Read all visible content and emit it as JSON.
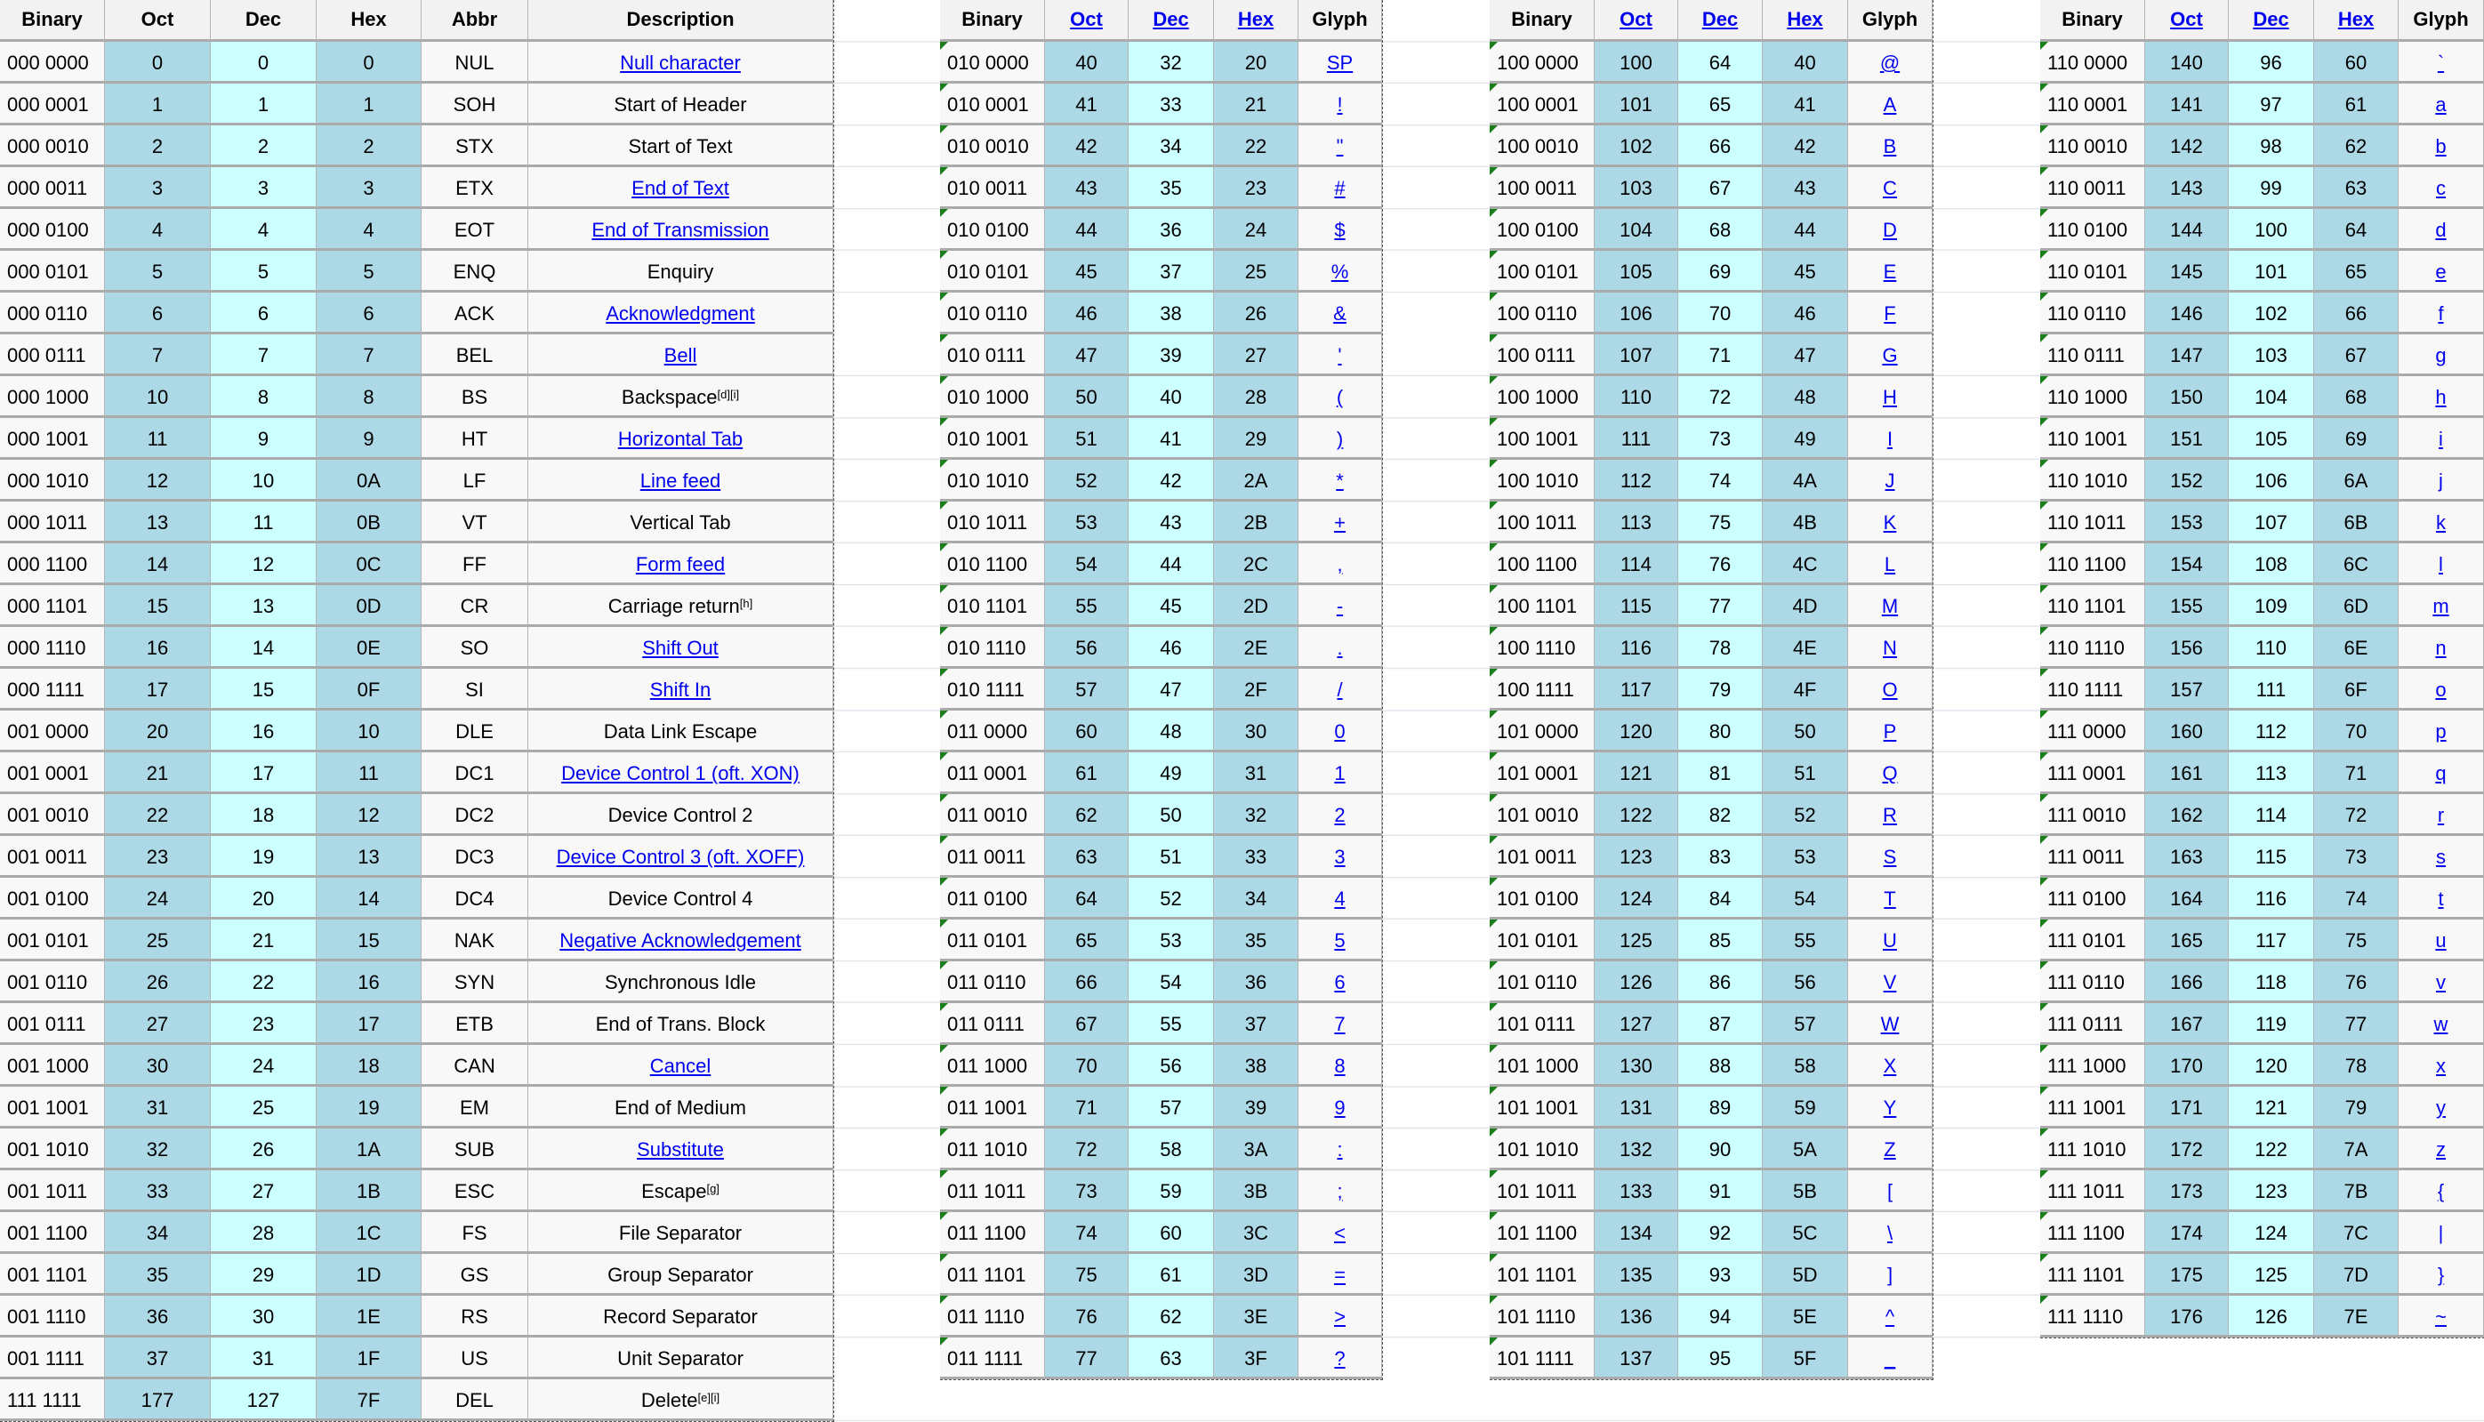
{
  "colors": {
    "header_bg": "#f2f2f2",
    "oct_hex_bg": "#add8e6",
    "dec_bg": "#ccffff",
    "link": "#0000ee",
    "cell_bg": "#f8f8f8"
  },
  "control_table": {
    "headers": [
      "Binary",
      "Oct",
      "Dec",
      "Hex",
      "Abbr",
      "Description"
    ],
    "rows": [
      [
        "000 0000",
        "0",
        "0",
        "0",
        "NUL",
        "Null character",
        true,
        ""
      ],
      [
        "000 0001",
        "1",
        "1",
        "1",
        "SOH",
        "Start of Header",
        false,
        ""
      ],
      [
        "000 0010",
        "2",
        "2",
        "2",
        "STX",
        "Start of Text",
        false,
        ""
      ],
      [
        "000 0011",
        "3",
        "3",
        "3",
        "ETX",
        "End of Text",
        true,
        ""
      ],
      [
        "000 0100",
        "4",
        "4",
        "4",
        "EOT",
        "End of Transmission",
        true,
        ""
      ],
      [
        "000 0101",
        "5",
        "5",
        "5",
        "ENQ",
        "Enquiry",
        false,
        ""
      ],
      [
        "000 0110",
        "6",
        "6",
        "6",
        "ACK",
        "Acknowledgment",
        true,
        ""
      ],
      [
        "000 0111",
        "7",
        "7",
        "7",
        "BEL",
        "Bell",
        true,
        ""
      ],
      [
        "000 1000",
        "10",
        "8",
        "8",
        "BS",
        "Backspace",
        false,
        "[d][i]"
      ],
      [
        "000 1001",
        "11",
        "9",
        "9",
        "HT",
        "Horizontal Tab",
        true,
        ""
      ],
      [
        "000 1010",
        "12",
        "10",
        "0A",
        "LF",
        "Line feed",
        true,
        ""
      ],
      [
        "000 1011",
        "13",
        "11",
        "0B",
        "VT",
        "Vertical Tab",
        false,
        ""
      ],
      [
        "000 1100",
        "14",
        "12",
        "0C",
        "FF",
        "Form feed",
        true,
        ""
      ],
      [
        "000 1101",
        "15",
        "13",
        "0D",
        "CR",
        "Carriage return",
        false,
        "[h]"
      ],
      [
        "000 1110",
        "16",
        "14",
        "0E",
        "SO",
        "Shift Out",
        true,
        ""
      ],
      [
        "000 1111",
        "17",
        "15",
        "0F",
        "SI",
        "Shift In",
        true,
        ""
      ],
      [
        "001 0000",
        "20",
        "16",
        "10",
        "DLE",
        "Data Link Escape",
        false,
        ""
      ],
      [
        "001 0001",
        "21",
        "17",
        "11",
        "DC1",
        "Device Control 1 (oft. XON)",
        true,
        ""
      ],
      [
        "001 0010",
        "22",
        "18",
        "12",
        "DC2",
        "Device Control 2",
        false,
        ""
      ],
      [
        "001 0011",
        "23",
        "19",
        "13",
        "DC3",
        "Device Control 3 (oft. XOFF)",
        true,
        ""
      ],
      [
        "001 0100",
        "24",
        "20",
        "14",
        "DC4",
        "Device Control 4",
        false,
        ""
      ],
      [
        "001 0101",
        "25",
        "21",
        "15",
        "NAK",
        "Negative Acknowledgement",
        true,
        ""
      ],
      [
        "001 0110",
        "26",
        "22",
        "16",
        "SYN",
        "Synchronous Idle",
        false,
        ""
      ],
      [
        "001 0111",
        "27",
        "23",
        "17",
        "ETB",
        "End of Trans. Block",
        false,
        ""
      ],
      [
        "001 1000",
        "30",
        "24",
        "18",
        "CAN",
        "Cancel",
        true,
        ""
      ],
      [
        "001 1001",
        "31",
        "25",
        "19",
        "EM",
        "End of Medium",
        false,
        ""
      ],
      [
        "001 1010",
        "32",
        "26",
        "1A",
        "SUB",
        "Substitute",
        true,
        ""
      ],
      [
        "001 1011",
        "33",
        "27",
        "1B",
        "ESC",
        "Escape",
        false,
        "[g]"
      ],
      [
        "001 1100",
        "34",
        "28",
        "1C",
        "FS",
        "File Separator",
        false,
        ""
      ],
      [
        "001 1101",
        "35",
        "29",
        "1D",
        "GS",
        "Group Separator",
        false,
        ""
      ],
      [
        "001 1110",
        "36",
        "30",
        "1E",
        "RS",
        "Record Separator",
        false,
        ""
      ],
      [
        "001 1111",
        "37",
        "31",
        "1F",
        "US",
        "Unit Separator",
        false,
        ""
      ],
      [
        "111 1111",
        "177",
        "127",
        "7F",
        "DEL",
        "Delete",
        false,
        "[e][i]"
      ]
    ]
  },
  "glyph_tables": [
    {
      "headers": [
        "Binary",
        "Oct",
        "Dec",
        "Hex",
        "Glyph"
      ],
      "rows": [
        [
          "010 0000",
          "40",
          "32",
          "20",
          "SP"
        ],
        [
          "010 0001",
          "41",
          "33",
          "21",
          "!"
        ],
        [
          "010 0010",
          "42",
          "34",
          "22",
          "\""
        ],
        [
          "010 0011",
          "43",
          "35",
          "23",
          "#"
        ],
        [
          "010 0100",
          "44",
          "36",
          "24",
          "$"
        ],
        [
          "010 0101",
          "45",
          "37",
          "25",
          "%"
        ],
        [
          "010 0110",
          "46",
          "38",
          "26",
          "&"
        ],
        [
          "010 0111",
          "47",
          "39",
          "27",
          "'"
        ],
        [
          "010 1000",
          "50",
          "40",
          "28",
          "("
        ],
        [
          "010 1001",
          "51",
          "41",
          "29",
          ")"
        ],
        [
          "010 1010",
          "52",
          "42",
          "2A",
          "*"
        ],
        [
          "010 1011",
          "53",
          "43",
          "2B",
          "+"
        ],
        [
          "010 1100",
          "54",
          "44",
          "2C",
          ","
        ],
        [
          "010 1101",
          "55",
          "45",
          "2D",
          "-"
        ],
        [
          "010 1110",
          "56",
          "46",
          "2E",
          "."
        ],
        [
          "010 1111",
          "57",
          "47",
          "2F",
          "/"
        ],
        [
          "011 0000",
          "60",
          "48",
          "30",
          "0"
        ],
        [
          "011 0001",
          "61",
          "49",
          "31",
          "1"
        ],
        [
          "011 0010",
          "62",
          "50",
          "32",
          "2"
        ],
        [
          "011 0011",
          "63",
          "51",
          "33",
          "3"
        ],
        [
          "011 0100",
          "64",
          "52",
          "34",
          "4"
        ],
        [
          "011 0101",
          "65",
          "53",
          "35",
          "5"
        ],
        [
          "011 0110",
          "66",
          "54",
          "36",
          "6"
        ],
        [
          "011 0111",
          "67",
          "55",
          "37",
          "7"
        ],
        [
          "011 1000",
          "70",
          "56",
          "38",
          "8"
        ],
        [
          "011 1001",
          "71",
          "57",
          "39",
          "9"
        ],
        [
          "011 1010",
          "72",
          "58",
          "3A",
          ":"
        ],
        [
          "011 1011",
          "73",
          "59",
          "3B",
          ";"
        ],
        [
          "011 1100",
          "74",
          "60",
          "3C",
          "<"
        ],
        [
          "011 1101",
          "75",
          "61",
          "3D",
          "="
        ],
        [
          "011 1110",
          "76",
          "62",
          "3E",
          ">"
        ],
        [
          "011 1111",
          "77",
          "63",
          "3F",
          "?"
        ]
      ]
    },
    {
      "headers": [
        "Binary",
        "Oct",
        "Dec",
        "Hex",
        "Glyph"
      ],
      "rows": [
        [
          "100 0000",
          "100",
          "64",
          "40",
          "@"
        ],
        [
          "100 0001",
          "101",
          "65",
          "41",
          "A"
        ],
        [
          "100 0010",
          "102",
          "66",
          "42",
          "B"
        ],
        [
          "100 0011",
          "103",
          "67",
          "43",
          "C"
        ],
        [
          "100 0100",
          "104",
          "68",
          "44",
          "D"
        ],
        [
          "100 0101",
          "105",
          "69",
          "45",
          "E"
        ],
        [
          "100 0110",
          "106",
          "70",
          "46",
          "F"
        ],
        [
          "100 0111",
          "107",
          "71",
          "47",
          "G"
        ],
        [
          "100 1000",
          "110",
          "72",
          "48",
          "H"
        ],
        [
          "100 1001",
          "111",
          "73",
          "49",
          "I"
        ],
        [
          "100 1010",
          "112",
          "74",
          "4A",
          "J"
        ],
        [
          "100 1011",
          "113",
          "75",
          "4B",
          "K"
        ],
        [
          "100 1100",
          "114",
          "76",
          "4C",
          "L"
        ],
        [
          "100 1101",
          "115",
          "77",
          "4D",
          "M"
        ],
        [
          "100 1110",
          "116",
          "78",
          "4E",
          "N"
        ],
        [
          "100 1111",
          "117",
          "79",
          "4F",
          "O"
        ],
        [
          "101 0000",
          "120",
          "80",
          "50",
          "P"
        ],
        [
          "101 0001",
          "121",
          "81",
          "51",
          "Q"
        ],
        [
          "101 0010",
          "122",
          "82",
          "52",
          "R"
        ],
        [
          "101 0011",
          "123",
          "83",
          "53",
          "S"
        ],
        [
          "101 0100",
          "124",
          "84",
          "54",
          "T"
        ],
        [
          "101 0101",
          "125",
          "85",
          "55",
          "U"
        ],
        [
          "101 0110",
          "126",
          "86",
          "56",
          "V"
        ],
        [
          "101 0111",
          "127",
          "87",
          "57",
          "W"
        ],
        [
          "101 1000",
          "130",
          "88",
          "58",
          "X"
        ],
        [
          "101 1001",
          "131",
          "89",
          "59",
          "Y"
        ],
        [
          "101 1010",
          "132",
          "90",
          "5A",
          "Z"
        ],
        [
          "101 1011",
          "133",
          "91",
          "5B",
          "["
        ],
        [
          "101 1100",
          "134",
          "92",
          "5C",
          "\\"
        ],
        [
          "101 1101",
          "135",
          "93",
          "5D",
          "]"
        ],
        [
          "101 1110",
          "136",
          "94",
          "5E",
          "^"
        ],
        [
          "101 1111",
          "137",
          "95",
          "5F",
          "_"
        ]
      ]
    },
    {
      "headers": [
        "Binary",
        "Oct",
        "Dec",
        "Hex",
        "Glyph"
      ],
      "rows": [
        [
          "110 0000",
          "140",
          "96",
          "60",
          "`"
        ],
        [
          "110 0001",
          "141",
          "97",
          "61",
          "a"
        ],
        [
          "110 0010",
          "142",
          "98",
          "62",
          "b"
        ],
        [
          "110 0011",
          "143",
          "99",
          "63",
          "c"
        ],
        [
          "110 0100",
          "144",
          "100",
          "64",
          "d"
        ],
        [
          "110 0101",
          "145",
          "101",
          "65",
          "e"
        ],
        [
          "110 0110",
          "146",
          "102",
          "66",
          "f"
        ],
        [
          "110 0111",
          "147",
          "103",
          "67",
          "g"
        ],
        [
          "110 1000",
          "150",
          "104",
          "68",
          "h"
        ],
        [
          "110 1001",
          "151",
          "105",
          "69",
          "i"
        ],
        [
          "110 1010",
          "152",
          "106",
          "6A",
          "j"
        ],
        [
          "110 1011",
          "153",
          "107",
          "6B",
          "k"
        ],
        [
          "110 1100",
          "154",
          "108",
          "6C",
          "l"
        ],
        [
          "110 1101",
          "155",
          "109",
          "6D",
          "m"
        ],
        [
          "110 1110",
          "156",
          "110",
          "6E",
          "n"
        ],
        [
          "110 1111",
          "157",
          "111",
          "6F",
          "o"
        ],
        [
          "111 0000",
          "160",
          "112",
          "70",
          "p"
        ],
        [
          "111 0001",
          "161",
          "113",
          "71",
          "q"
        ],
        [
          "111 0010",
          "162",
          "114",
          "72",
          "r"
        ],
        [
          "111 0011",
          "163",
          "115",
          "73",
          "s"
        ],
        [
          "111 0100",
          "164",
          "116",
          "74",
          "t"
        ],
        [
          "111 0101",
          "165",
          "117",
          "75",
          "u"
        ],
        [
          "111 0110",
          "166",
          "118",
          "76",
          "v"
        ],
        [
          "111 0111",
          "167",
          "119",
          "77",
          "w"
        ],
        [
          "111 1000",
          "170",
          "120",
          "78",
          "x"
        ],
        [
          "111 1001",
          "171",
          "121",
          "79",
          "y"
        ],
        [
          "111 1010",
          "172",
          "122",
          "7A",
          "z"
        ],
        [
          "111 1011",
          "173",
          "123",
          "7B",
          "{"
        ],
        [
          "111 1100",
          "174",
          "124",
          "7C",
          "|"
        ],
        [
          "111 1101",
          "175",
          "125",
          "7D",
          "}"
        ],
        [
          "111 1110",
          "176",
          "126",
          "7E",
          "~"
        ]
      ]
    }
  ]
}
